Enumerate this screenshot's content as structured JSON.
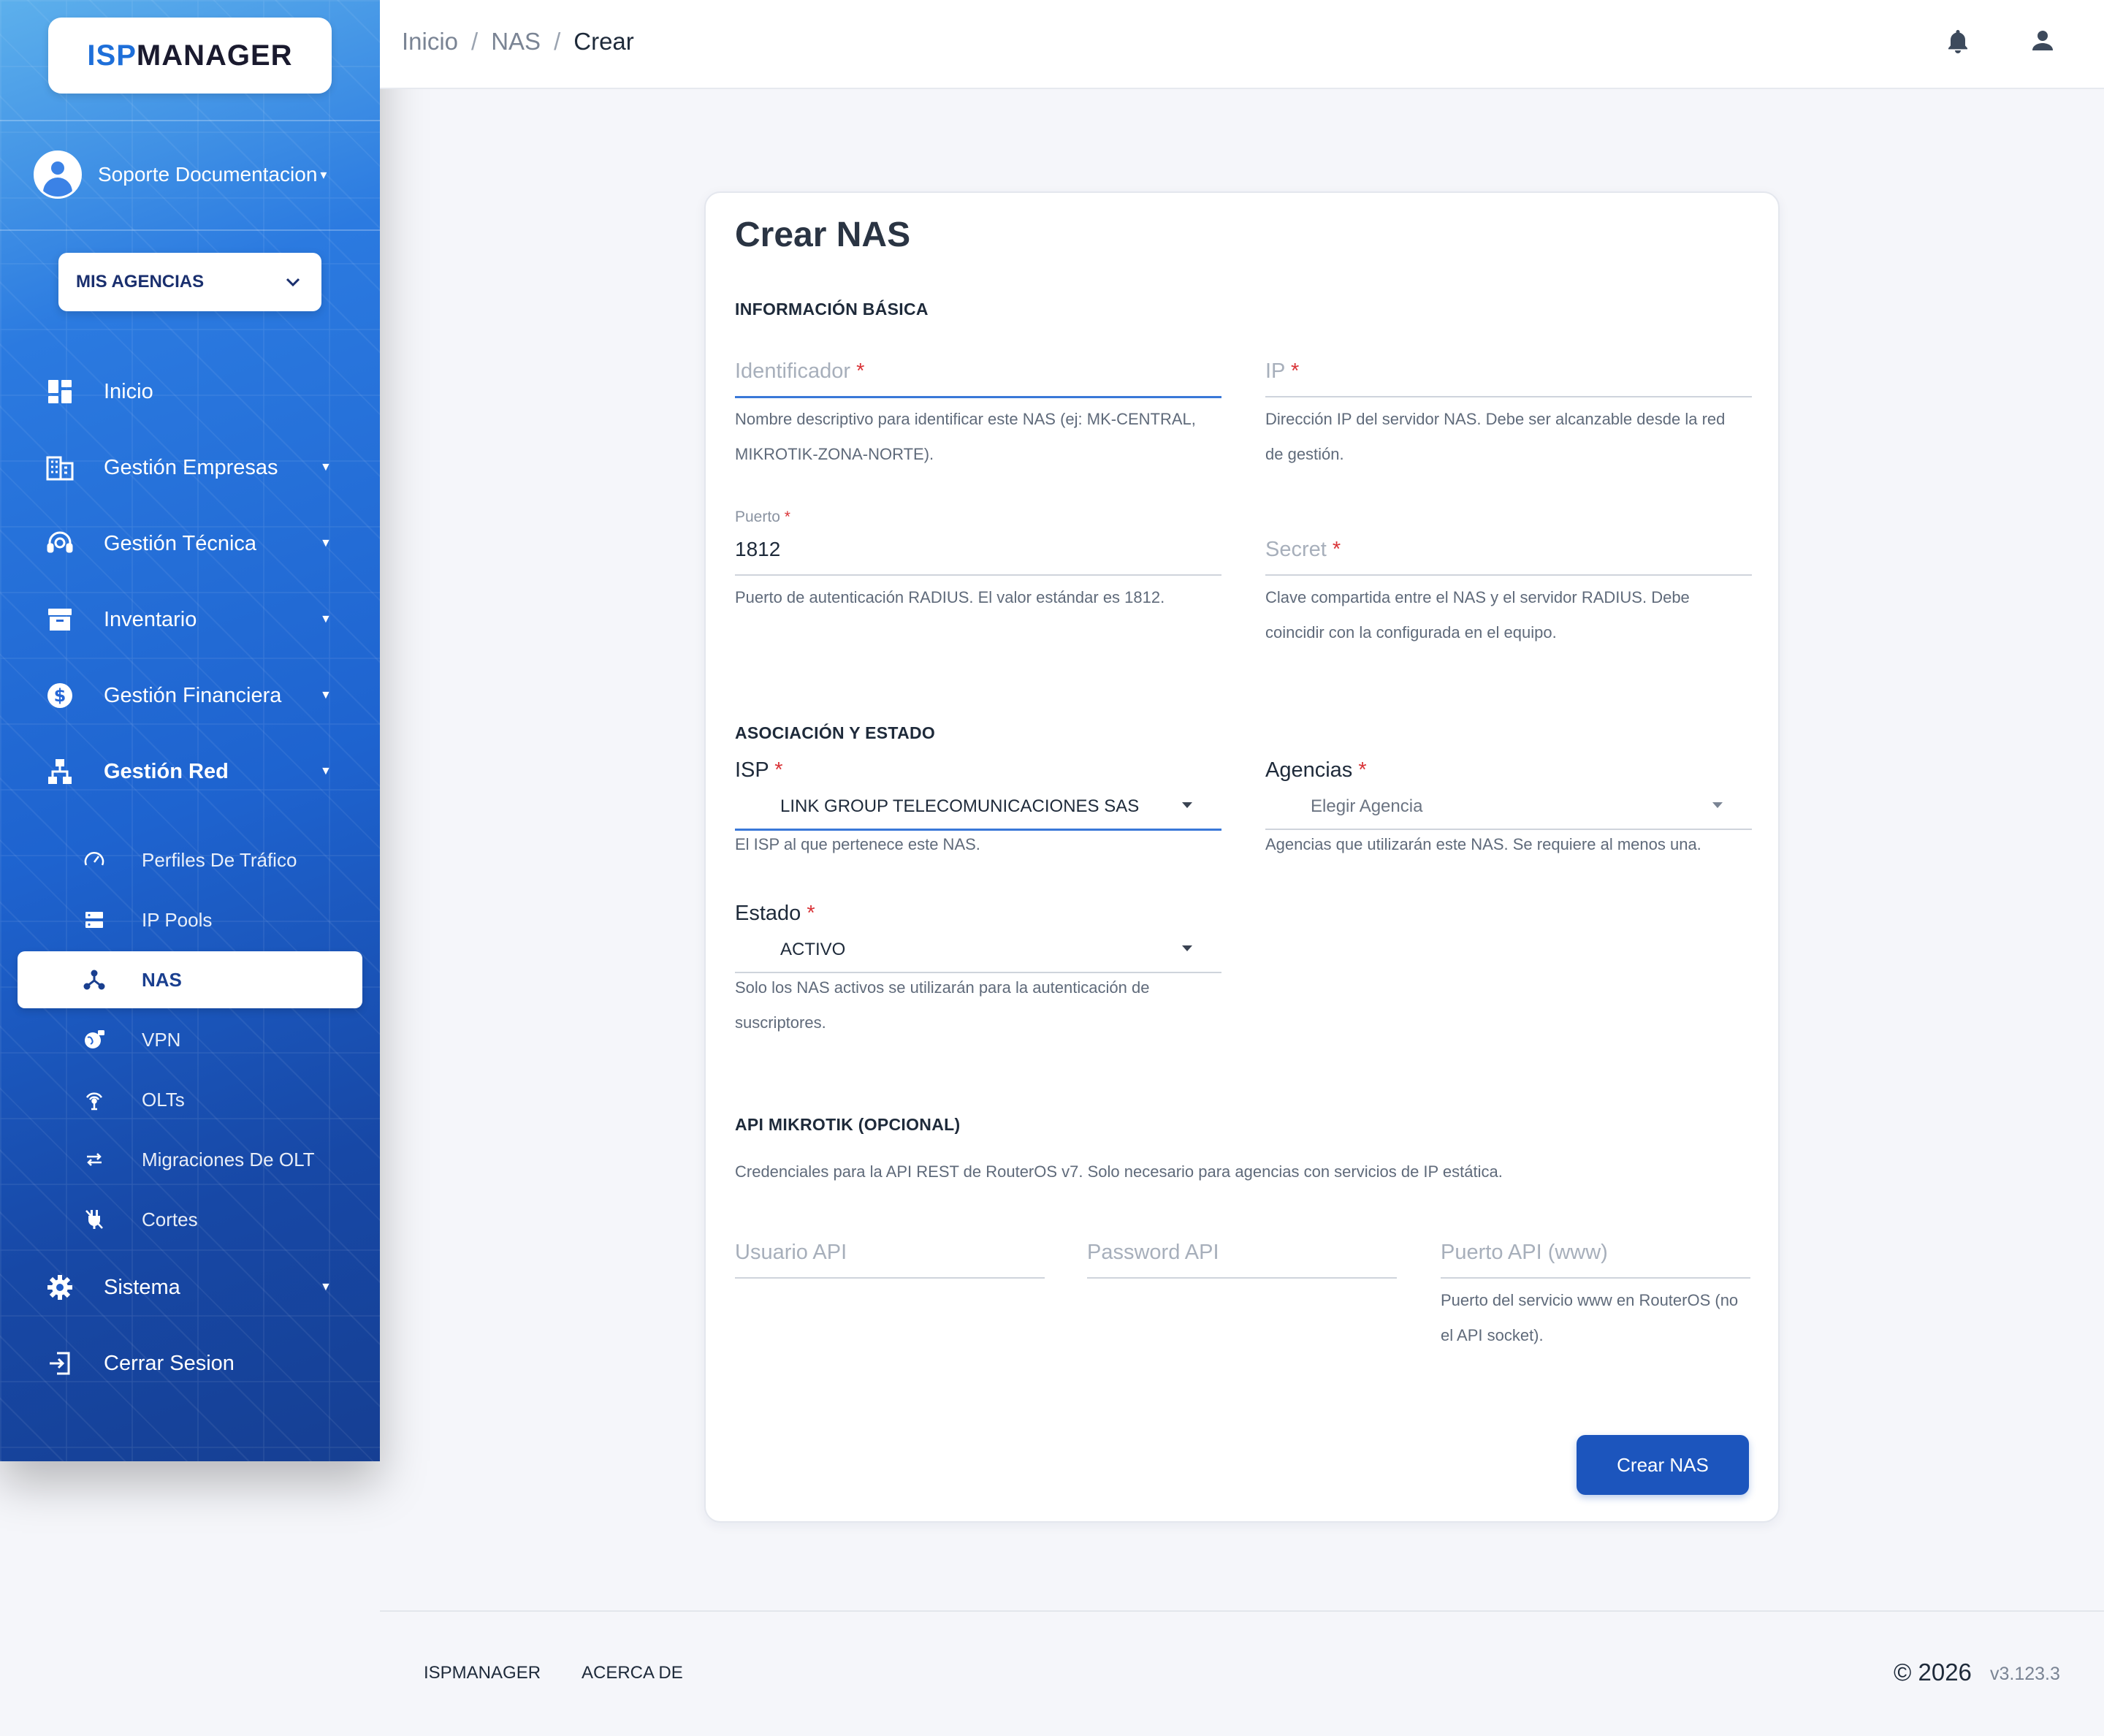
{
  "brand": {
    "logo_part1": "ISP",
    "logo_part2": "MANAGER"
  },
  "user": {
    "name": "Soporte Documentacion"
  },
  "agency_selector": {
    "label": "MIS AGENCIAS"
  },
  "nav": {
    "inicio": "Inicio",
    "gestion_empresas": "Gestión Empresas",
    "gestion_tecnica": "Gestión Técnica",
    "inventario": "Inventario",
    "gestion_financiera": "Gestión Financiera",
    "gestion_red": "Gestión Red",
    "sistema": "Sistema",
    "cerrar_sesion": "Cerrar Sesion",
    "sub": {
      "perfiles": "Perfiles De Tráfico",
      "ip_pools": "IP Pools",
      "nas": "NAS",
      "vpn": "VPN",
      "olts": "OLTs",
      "migraciones": "Migraciones De OLT",
      "cortes": "Cortes"
    }
  },
  "breadcrumb": {
    "c1": "Inicio",
    "c2": "NAS",
    "c3": "Crear",
    "sep": "/"
  },
  "form": {
    "title": "Crear NAS",
    "sections": {
      "basic": "INFORMACIÓN BÁSICA",
      "assoc": "ASOCIACIÓN Y ESTADO",
      "api": "API MIKROTIK (OPCIONAL)"
    },
    "identificador": {
      "placeholder": "Identificador",
      "help1": "Nombre descriptivo para identificar este NAS (ej: MK-CENTRAL,",
      "help2": "MIKROTIK-ZONA-NORTE)."
    },
    "ip": {
      "placeholder": "IP",
      "help1": "Dirección IP del servidor NAS. Debe ser alcanzable desde la red",
      "help2": "de gestión."
    },
    "puerto": {
      "label": "Puerto",
      "value": "1812",
      "help": "Puerto de autenticación RADIUS. El valor estándar es 1812."
    },
    "secret": {
      "placeholder": "Secret",
      "help1": "Clave compartida entre el NAS y el servidor RADIUS. Debe",
      "help2": "coincidir con la configurada en el equipo."
    },
    "isp": {
      "label": "ISP",
      "value": "LINK GROUP TELECOMUNICACIONES SAS",
      "help": "El ISP al que pertenece este NAS."
    },
    "agencias": {
      "label": "Agencias",
      "placeholder": "Elegir Agencia",
      "help": "Agencias que utilizarán este NAS. Se requiere al menos una."
    },
    "estado": {
      "label": "Estado",
      "value": "ACTIVO",
      "help1": "Solo los NAS activos se utilizarán para la autenticación de",
      "help2": "suscriptores."
    },
    "api_desc": "Credenciales para la API REST de RouterOS v7. Solo necesario para agencias con servicios de IP estática.",
    "usuario_api": {
      "placeholder": "Usuario API"
    },
    "password_api": {
      "placeholder": "Password API"
    },
    "puerto_api": {
      "placeholder": "Puerto API (www)",
      "help1": "Puerto del servicio www en RouterOS (no",
      "help2": "el API socket)."
    },
    "submit": "Crear NAS",
    "required_mark": "*"
  },
  "footer": {
    "link1": "ISPMANAGER",
    "link2": "ACERCA DE",
    "copyright": "© 2026",
    "version": "v3.123.3"
  },
  "colors": {
    "primary": "#1c55bd",
    "sidebar_top": "#5db0ec",
    "sidebar_bottom": "#163f93",
    "required": "#d93438",
    "focus": "#3a78d8"
  }
}
